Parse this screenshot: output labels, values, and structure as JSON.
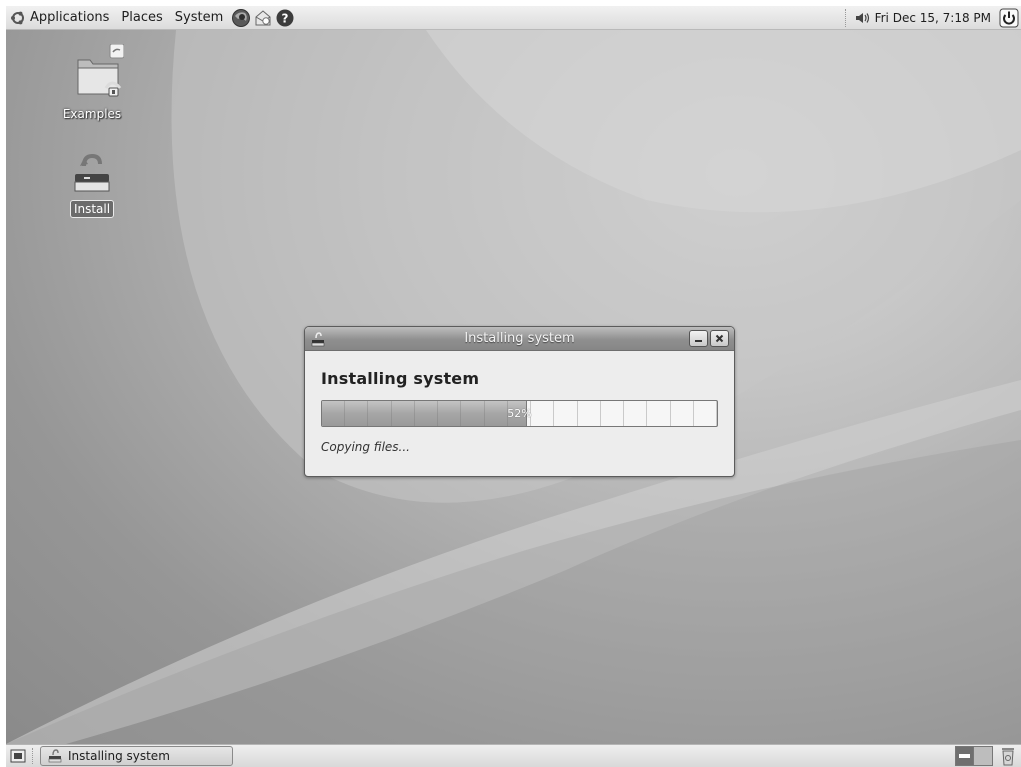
{
  "top_panel": {
    "menus": [
      "Applications",
      "Places",
      "System"
    ],
    "launchers": [
      "firefox-icon",
      "mail-icon",
      "help-icon"
    ],
    "clock": "Fri Dec 15,  7:18 PM"
  },
  "desktop": {
    "icons": [
      {
        "label": "Examples",
        "icon": "folder-icon"
      },
      {
        "label": "Install",
        "icon": "installer-icon"
      }
    ]
  },
  "dialog": {
    "window_title": "Installing system",
    "heading": "Installing system",
    "progress_label": "52%",
    "progress_value": 0.52,
    "status": "Copying files..."
  },
  "bottom_panel": {
    "task_title": "Installing system",
    "workspaces": 2
  }
}
